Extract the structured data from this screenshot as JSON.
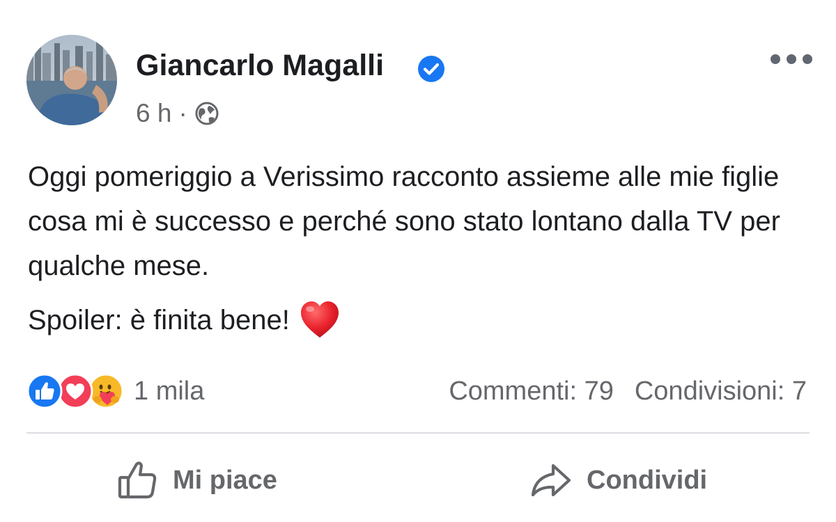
{
  "post": {
    "author": {
      "name": "Giancarlo Magalli",
      "verified": true
    },
    "time": "6 h",
    "separator": "·",
    "audience_icon": "globe-icon",
    "more_icon": "more-options-icon",
    "body": {
      "paragraph1": "Oggi pomeriggio a Verissimo racconto assieme alle mie figlie cosa mi è successo e perché sono stato lontano dalla TV per qualche mese.",
      "paragraph2": "Spoiler: è finita bene!",
      "emoji": "red-heart-emoji"
    },
    "reactions": {
      "icons": [
        "like-reaction-icon",
        "love-reaction-icon",
        "care-reaction-icon"
      ],
      "count": "1 mila"
    },
    "stats": {
      "comments": "Commenti: 79",
      "shares": "Condivisioni: 7"
    },
    "actions": {
      "like_label": "Mi piace",
      "share_label": "Condividi"
    },
    "colors": {
      "verified_blue": "#1877f2",
      "love_red": "#f33e58",
      "text_primary": "#1c1e21",
      "text_secondary": "#65676b"
    }
  }
}
